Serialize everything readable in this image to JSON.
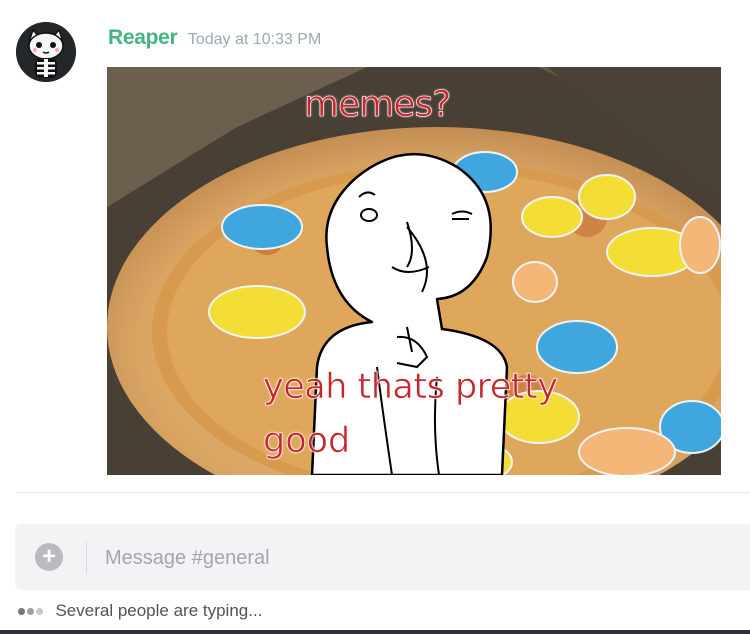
{
  "message": {
    "author": "Reaper",
    "timestamp": "Today at 10:33 PM",
    "author_color": "#43b581",
    "avatar_icon": "skeleton-cat-icon",
    "image": {
      "top_text": "memes?",
      "bottom_text_line1": "yeah thats pretty",
      "bottom_text_line2": "good",
      "text_color": "#c8262d"
    }
  },
  "composer": {
    "upload_icon": "plus-circle-icon",
    "placeholder": "Message #general"
  },
  "typing_indicator": {
    "text": "Several people are typing..."
  }
}
